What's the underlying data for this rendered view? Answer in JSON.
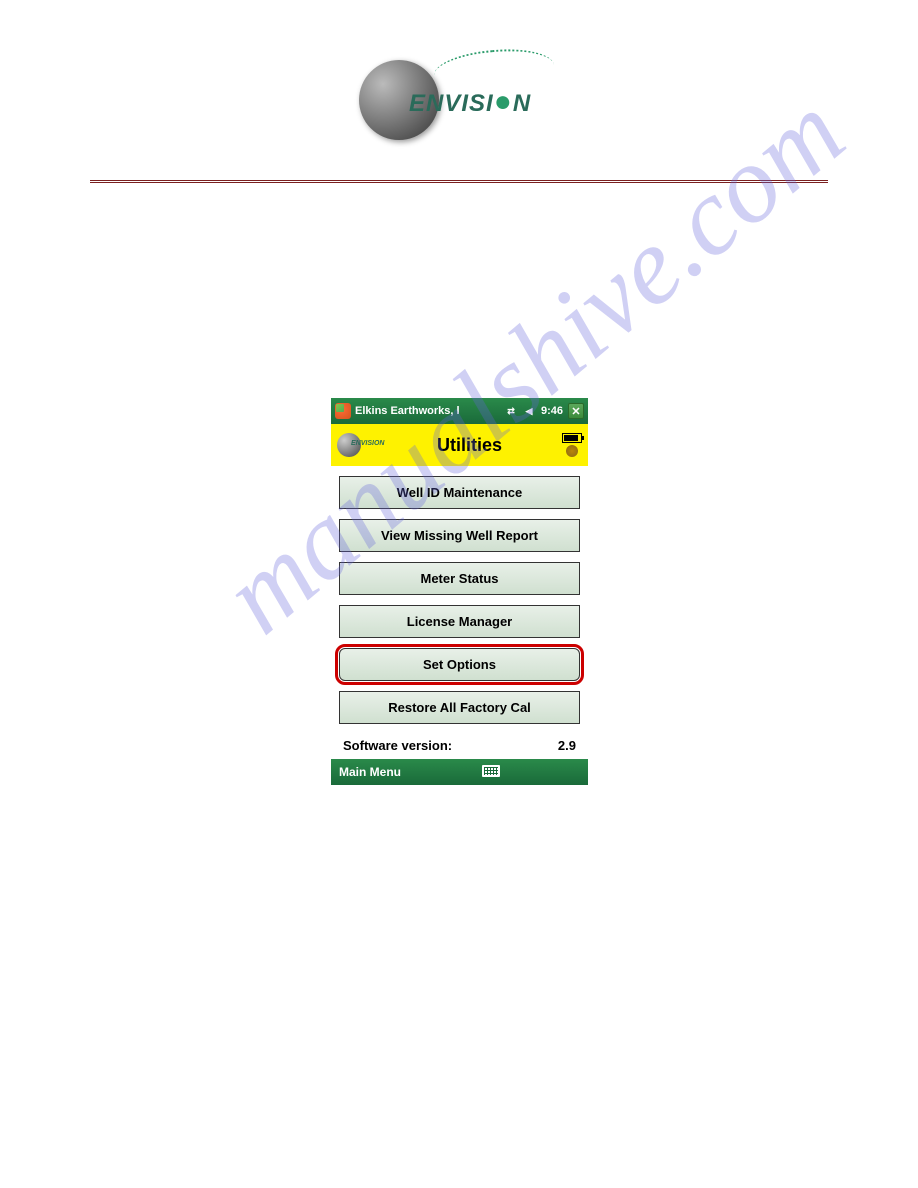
{
  "header": {
    "logo_text": "ENVISION"
  },
  "watermark": "manualshive.com",
  "device": {
    "titlebar": {
      "title": "Elkins Earthworks, l",
      "time": "9:46"
    },
    "app_header": {
      "logo_text": "ENVISION",
      "title": "Utilities"
    },
    "buttons": {
      "b0": "Well ID Maintenance",
      "b1": "View Missing Well Report",
      "b2": "Meter Status",
      "b3": "License Manager",
      "b4": "Set Options",
      "b5": "Restore All Factory Cal"
    },
    "version": {
      "label": "Software version:",
      "value": "2.9"
    },
    "bottombar": {
      "left": "Main Menu"
    }
  }
}
